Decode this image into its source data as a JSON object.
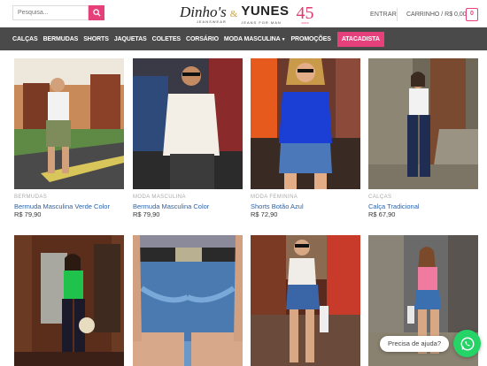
{
  "header": {
    "search_placeholder": "Pesquisa...",
    "logo": {
      "brand1": "Dinho's",
      "brand1_sub": "JEANSWEAR",
      "amp": "&",
      "brand2": "YUNES",
      "brand2_sub": "JEANS FOR MAN",
      "anniversary": "45",
      "anniversary_sub": "ANOS"
    },
    "login_label": "ENTRAR",
    "cart_label": "CARRINHO / R$ 0,00",
    "cart_count": "0"
  },
  "nav": {
    "items": [
      "CALÇAS",
      "BERMUDAS",
      "SHORTS",
      "JAQUETAS",
      "COLETES",
      "CORSÁRIO",
      "MODA MASCULINA",
      "PROMOÇÕES"
    ],
    "highlight": "ATACADISTA"
  },
  "products": [
    {
      "category": "BERMUDAS",
      "name": "Bermuda Masculina Verde Color",
      "price": "R$ 79,90"
    },
    {
      "category": "MODA MASCULINA",
      "name": "Bermuda Masculina Color",
      "price": "R$ 79,90"
    },
    {
      "category": "MODA FEMININA",
      "name": "Shorts Botão Azul",
      "price": "R$ 72,90"
    },
    {
      "category": "CALÇAS",
      "name": "Calça Tradicional",
      "price": "R$ 67,90"
    }
  ],
  "whatsapp": {
    "label": "Precisa de ajuda?",
    "icon": "whatsapp-icon"
  },
  "colors": {
    "accent": "#e5407a",
    "nav_bg": "#4a4a4a",
    "link": "#2a62a8",
    "whatsapp": "#25d366"
  }
}
